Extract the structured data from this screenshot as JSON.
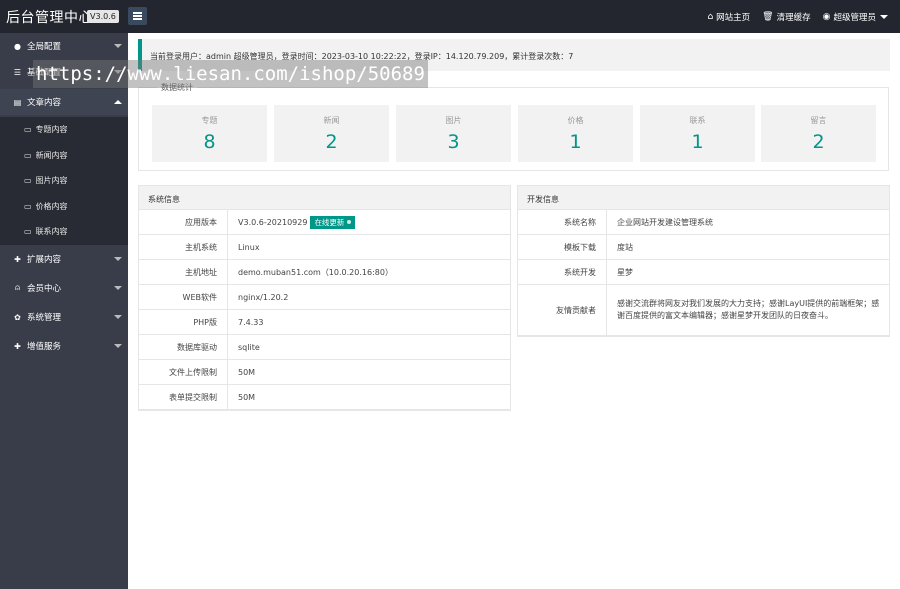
{
  "header": {
    "brand": "后台管理中心",
    "version": "V3.0.6",
    "links": [
      {
        "icon": "home-icon",
        "label": "网站主页"
      },
      {
        "icon": "trash-icon",
        "label": "清理缓存"
      },
      {
        "icon": "user-icon",
        "label": "超级管理员"
      }
    ]
  },
  "sidebar": {
    "items": [
      {
        "icon": "globe-icon",
        "label": "全局配置"
      },
      {
        "icon": "sliders-icon",
        "label": "基础配置"
      },
      {
        "icon": "document-icon",
        "label": "文章内容"
      },
      {
        "icon": "puzzle-icon",
        "label": "扩展内容"
      },
      {
        "icon": "user-icon",
        "label": "会员中心"
      },
      {
        "icon": "gear-icon",
        "label": "系统管理"
      },
      {
        "icon": "puzzle-icon",
        "label": "增值服务"
      }
    ],
    "subitems": [
      {
        "icon": "file-icon",
        "label": "专题内容"
      },
      {
        "icon": "file-icon",
        "label": "新闻内容"
      },
      {
        "icon": "file-icon",
        "label": "图片内容"
      },
      {
        "icon": "file-icon",
        "label": "价格内容"
      },
      {
        "icon": "file-icon",
        "label": "联系内容"
      }
    ]
  },
  "login_info": "当前登录用户：admin 超级管理员，登录时间：2023-03-10 10:22:22，登录IP：14.120.79.209，累计登录次数：7",
  "stats": {
    "title": "数据统计",
    "cards": [
      {
        "label": "专题",
        "value": "8"
      },
      {
        "label": "新闻",
        "value": "2"
      },
      {
        "label": "图片",
        "value": "3"
      },
      {
        "label": "价格",
        "value": "1"
      },
      {
        "label": "联系",
        "value": "1"
      },
      {
        "label": "留言",
        "value": "2"
      }
    ]
  },
  "system_info": {
    "title": "系统信息",
    "rows": [
      {
        "key": "应用版本",
        "value": "V3.0.6-20210929"
      },
      {
        "key": "主机系统",
        "value": "Linux"
      },
      {
        "key": "主机地址",
        "value": "demo.muban51.com（10.0.20.16:80）"
      },
      {
        "key": "WEB软件",
        "value": "nginx/1.20.2"
      },
      {
        "key": "PHP版",
        "value": "7.4.33"
      },
      {
        "key": "数据库驱动",
        "value": "sqlite"
      },
      {
        "key": "文件上传限制",
        "value": "50M"
      },
      {
        "key": "表单提交限制",
        "value": "50M"
      }
    ],
    "update_badge": "在线更新"
  },
  "dev_info": {
    "title": "开发信息",
    "rows": [
      {
        "key": "系统名称",
        "value": "企业网站开发建设管理系统"
      },
      {
        "key": "模板下载",
        "value": "度站"
      },
      {
        "key": "系统开发",
        "value": "星梦"
      },
      {
        "key": "友情贡献者",
        "value": "感谢交流群将网友对我们发展的大力支持；感谢LayUI提供的前端框架；感谢百度提供的富文本编辑器；感谢星梦开发团队的日夜奋斗。"
      }
    ]
  },
  "watermark": "https://www.liesan.com/ishop/50689",
  "colors": {
    "accent": "#009688",
    "sidebar": "#393d49",
    "header": "#23262e"
  }
}
